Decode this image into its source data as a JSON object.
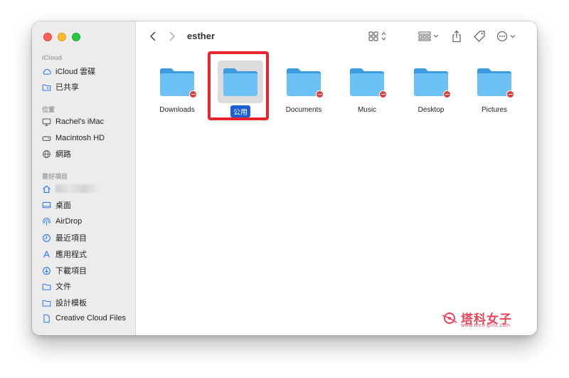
{
  "window": {
    "path_title": "esther"
  },
  "sidebar": {
    "sections": [
      {
        "label": "iCloud",
        "items": [
          {
            "label": "iCloud 雲碟",
            "icon": "cloud-icon"
          },
          {
            "label": "已共享",
            "icon": "shared-folder-icon"
          }
        ]
      },
      {
        "label": "位置",
        "items": [
          {
            "label": "Rachel's iMac",
            "icon": "imac-icon"
          },
          {
            "label": "Macintosh HD",
            "icon": "disk-icon"
          },
          {
            "label": "網路",
            "icon": "globe-icon"
          }
        ]
      },
      {
        "label": "喜好項目",
        "items": [
          {
            "label": "",
            "icon": "home-icon",
            "blurred": true
          },
          {
            "label": "桌面",
            "icon": "desktop-icon"
          },
          {
            "label": "AirDrop",
            "icon": "airdrop-icon"
          },
          {
            "label": "最近項目",
            "icon": "clock-icon"
          },
          {
            "label": "應用程式",
            "icon": "apps-icon"
          },
          {
            "label": "下載項目",
            "icon": "download-icon"
          },
          {
            "label": "文件",
            "icon": "document-icon"
          },
          {
            "label": "設計模板",
            "icon": "folder-icon"
          },
          {
            "label": "Creative Cloud Files",
            "icon": "file-icon"
          }
        ]
      }
    ]
  },
  "files": [
    {
      "label": "Downloads",
      "restricted": true
    },
    {
      "label": "公用",
      "restricted": false,
      "selected": true
    },
    {
      "label": "Documents",
      "restricted": true
    },
    {
      "label": "Music",
      "restricted": true
    },
    {
      "label": "Desktop",
      "restricted": true
    },
    {
      "label": "Pictures",
      "restricted": true
    }
  ],
  "watermark": {
    "title": "塔科女子",
    "subtitle": "www.tech-girlz.com"
  },
  "colors": {
    "accent": "#1c5fd4",
    "folder": "#5cb8f0",
    "highlight": "#e8242e",
    "watermark": "#e9445a"
  }
}
